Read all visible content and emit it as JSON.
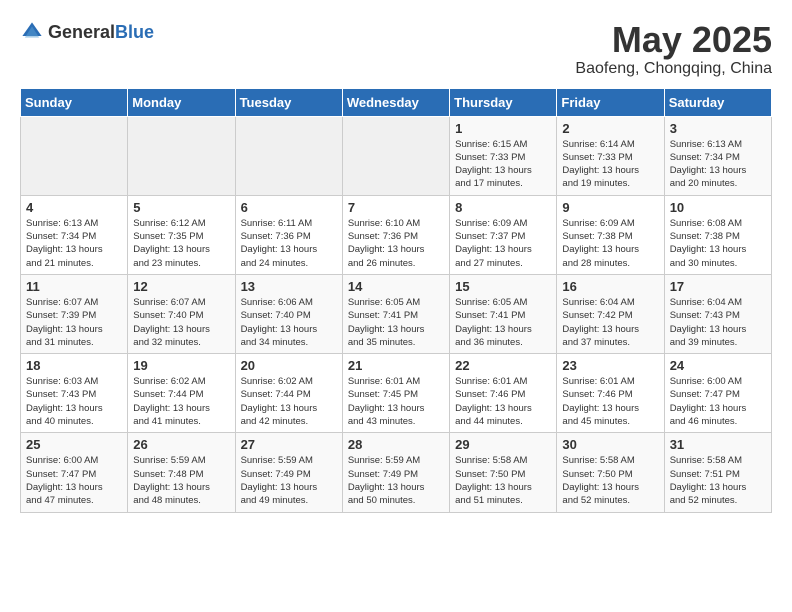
{
  "logo": {
    "general": "General",
    "blue": "Blue"
  },
  "title": "May 2025",
  "subtitle": "Baofeng, Chongqing, China",
  "days_of_week": [
    "Sunday",
    "Monday",
    "Tuesday",
    "Wednesday",
    "Thursday",
    "Friday",
    "Saturday"
  ],
  "weeks": [
    [
      {
        "day": "",
        "info": ""
      },
      {
        "day": "",
        "info": ""
      },
      {
        "day": "",
        "info": ""
      },
      {
        "day": "",
        "info": ""
      },
      {
        "day": "1",
        "info": "Sunrise: 6:15 AM\nSunset: 7:33 PM\nDaylight: 13 hours\nand 17 minutes."
      },
      {
        "day": "2",
        "info": "Sunrise: 6:14 AM\nSunset: 7:33 PM\nDaylight: 13 hours\nand 19 minutes."
      },
      {
        "day": "3",
        "info": "Sunrise: 6:13 AM\nSunset: 7:34 PM\nDaylight: 13 hours\nand 20 minutes."
      }
    ],
    [
      {
        "day": "4",
        "info": "Sunrise: 6:13 AM\nSunset: 7:34 PM\nDaylight: 13 hours\nand 21 minutes."
      },
      {
        "day": "5",
        "info": "Sunrise: 6:12 AM\nSunset: 7:35 PM\nDaylight: 13 hours\nand 23 minutes."
      },
      {
        "day": "6",
        "info": "Sunrise: 6:11 AM\nSunset: 7:36 PM\nDaylight: 13 hours\nand 24 minutes."
      },
      {
        "day": "7",
        "info": "Sunrise: 6:10 AM\nSunset: 7:36 PM\nDaylight: 13 hours\nand 26 minutes."
      },
      {
        "day": "8",
        "info": "Sunrise: 6:09 AM\nSunset: 7:37 PM\nDaylight: 13 hours\nand 27 minutes."
      },
      {
        "day": "9",
        "info": "Sunrise: 6:09 AM\nSunset: 7:38 PM\nDaylight: 13 hours\nand 28 minutes."
      },
      {
        "day": "10",
        "info": "Sunrise: 6:08 AM\nSunset: 7:38 PM\nDaylight: 13 hours\nand 30 minutes."
      }
    ],
    [
      {
        "day": "11",
        "info": "Sunrise: 6:07 AM\nSunset: 7:39 PM\nDaylight: 13 hours\nand 31 minutes."
      },
      {
        "day": "12",
        "info": "Sunrise: 6:07 AM\nSunset: 7:40 PM\nDaylight: 13 hours\nand 32 minutes."
      },
      {
        "day": "13",
        "info": "Sunrise: 6:06 AM\nSunset: 7:40 PM\nDaylight: 13 hours\nand 34 minutes."
      },
      {
        "day": "14",
        "info": "Sunrise: 6:05 AM\nSunset: 7:41 PM\nDaylight: 13 hours\nand 35 minutes."
      },
      {
        "day": "15",
        "info": "Sunrise: 6:05 AM\nSunset: 7:41 PM\nDaylight: 13 hours\nand 36 minutes."
      },
      {
        "day": "16",
        "info": "Sunrise: 6:04 AM\nSunset: 7:42 PM\nDaylight: 13 hours\nand 37 minutes."
      },
      {
        "day": "17",
        "info": "Sunrise: 6:04 AM\nSunset: 7:43 PM\nDaylight: 13 hours\nand 39 minutes."
      }
    ],
    [
      {
        "day": "18",
        "info": "Sunrise: 6:03 AM\nSunset: 7:43 PM\nDaylight: 13 hours\nand 40 minutes."
      },
      {
        "day": "19",
        "info": "Sunrise: 6:02 AM\nSunset: 7:44 PM\nDaylight: 13 hours\nand 41 minutes."
      },
      {
        "day": "20",
        "info": "Sunrise: 6:02 AM\nSunset: 7:44 PM\nDaylight: 13 hours\nand 42 minutes."
      },
      {
        "day": "21",
        "info": "Sunrise: 6:01 AM\nSunset: 7:45 PM\nDaylight: 13 hours\nand 43 minutes."
      },
      {
        "day": "22",
        "info": "Sunrise: 6:01 AM\nSunset: 7:46 PM\nDaylight: 13 hours\nand 44 minutes."
      },
      {
        "day": "23",
        "info": "Sunrise: 6:01 AM\nSunset: 7:46 PM\nDaylight: 13 hours\nand 45 minutes."
      },
      {
        "day": "24",
        "info": "Sunrise: 6:00 AM\nSunset: 7:47 PM\nDaylight: 13 hours\nand 46 minutes."
      }
    ],
    [
      {
        "day": "25",
        "info": "Sunrise: 6:00 AM\nSunset: 7:47 PM\nDaylight: 13 hours\nand 47 minutes."
      },
      {
        "day": "26",
        "info": "Sunrise: 5:59 AM\nSunset: 7:48 PM\nDaylight: 13 hours\nand 48 minutes."
      },
      {
        "day": "27",
        "info": "Sunrise: 5:59 AM\nSunset: 7:49 PM\nDaylight: 13 hours\nand 49 minutes."
      },
      {
        "day": "28",
        "info": "Sunrise: 5:59 AM\nSunset: 7:49 PM\nDaylight: 13 hours\nand 50 minutes."
      },
      {
        "day": "29",
        "info": "Sunrise: 5:58 AM\nSunset: 7:50 PM\nDaylight: 13 hours\nand 51 minutes."
      },
      {
        "day": "30",
        "info": "Sunrise: 5:58 AM\nSunset: 7:50 PM\nDaylight: 13 hours\nand 52 minutes."
      },
      {
        "day": "31",
        "info": "Sunrise: 5:58 AM\nSunset: 7:51 PM\nDaylight: 13 hours\nand 52 minutes."
      }
    ]
  ]
}
